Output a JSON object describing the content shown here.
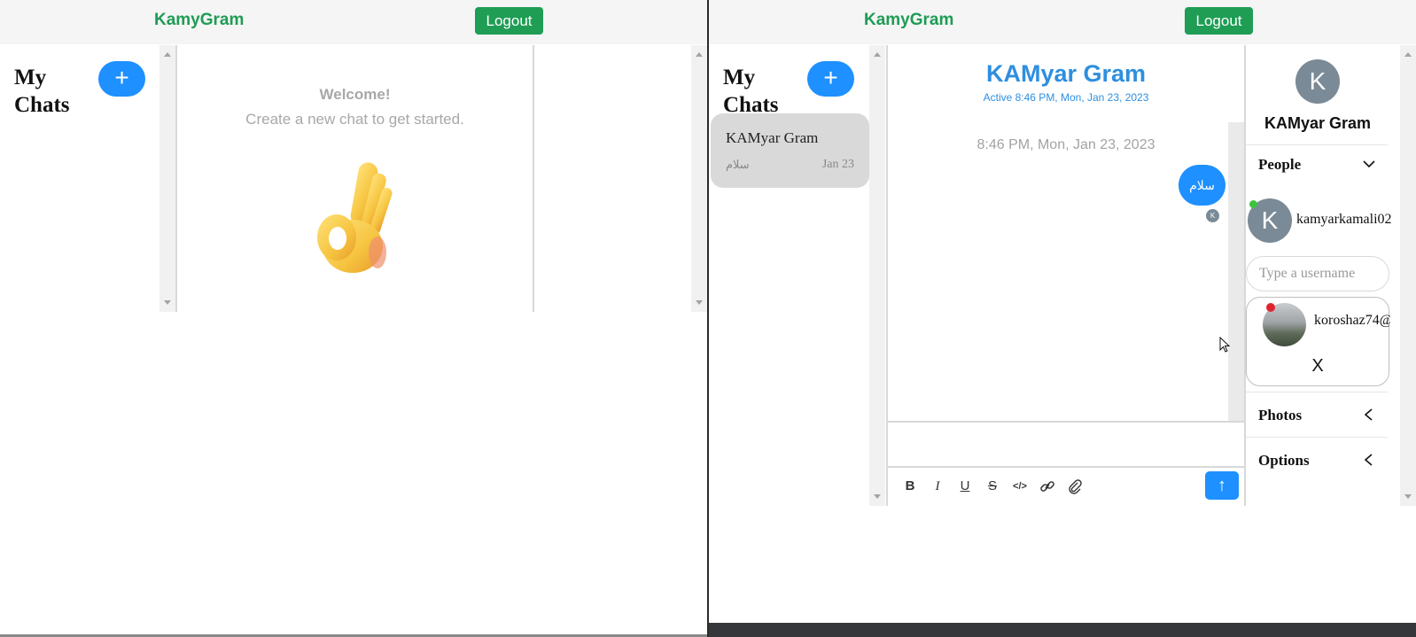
{
  "left_window": {
    "brand": "KamyGram",
    "logout_label": "Logout",
    "sidebar": {
      "title_line1": "My",
      "title_line2": "Chats",
      "new_chat_label": "+"
    },
    "welcome": {
      "title": "Welcome!",
      "subtitle": "Create a new chat to get started.",
      "emoji": "👌"
    }
  },
  "right_window": {
    "brand": "KamyGram",
    "logout_label": "Logout",
    "sidebar": {
      "title_line1": "My",
      "title_line2": "Chats",
      "new_chat_label": "+",
      "chats": [
        {
          "name": "KAMyar Gram",
          "preview": "سلام",
          "date": "Jan 23"
        }
      ]
    },
    "chat": {
      "title": "KAMyar Gram",
      "active_status": "Active 8:46 PM, Mon, Jan 23, 2023",
      "messages": [
        {
          "timestamp": "8:46 PM, Mon, Jan 23, 2023",
          "text": "سلام",
          "read_by_initial": "K"
        }
      ],
      "toolbar": {
        "bold": "B",
        "italic": "I",
        "underline": "U",
        "strikethrough": "S",
        "code": "</>",
        "send": "↑"
      }
    },
    "settings": {
      "avatar_initial": "K",
      "chat_name": "KAMyar Gram",
      "people_label": "People",
      "people": [
        {
          "initial": "K",
          "username": "kamyarkamali02",
          "online": true
        }
      ],
      "username_placeholder": "Type a username",
      "search_results": [
        {
          "username": "koroshaz74@",
          "online": false
        }
      ],
      "remove_label": "X",
      "photos_label": "Photos",
      "options_label": "Options"
    }
  },
  "colors": {
    "brand_green": "#1e9c55",
    "accent_blue": "#1e90ff",
    "title_blue": "#2e8fe0",
    "online": "#3fc23f",
    "offline": "#e0242e"
  }
}
